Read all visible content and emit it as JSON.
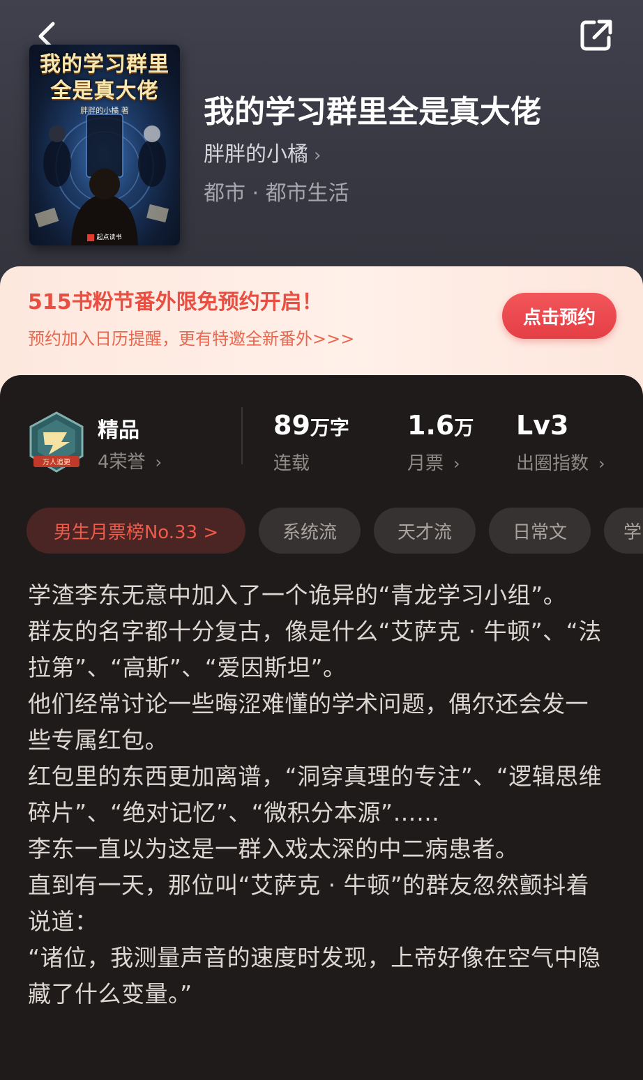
{
  "header": {
    "back": "back-arrow-icon",
    "share": "share-icon"
  },
  "book": {
    "cover_title_line1": "我的学习群里",
    "cover_title_line2": "全是真大佬",
    "cover_author": "胖胖的小橘 著",
    "cover_publisher": "起点读书",
    "title": "我的学习群里全是真大佬",
    "author": "胖胖的小橘",
    "genre": "都市 · 都市生活"
  },
  "promo": {
    "title": "515书粉节番外限免预约开启！",
    "subtitle": "预约加入日历提醒，更有特邀全新番外>>>",
    "button": "点击预约"
  },
  "stats": {
    "quality": "精品",
    "honors": "4荣誉",
    "badge_text": "万人追更",
    "words_num": "89",
    "words_unit": "万字",
    "words_label": "连载",
    "tickets_num": "1.6",
    "tickets_unit": "万",
    "tickets_label": "月票",
    "level": "Lv3",
    "level_label": "出圈指数",
    "chevron": "›"
  },
  "tags": [
    "男生月票榜No.33 >",
    "系统流",
    "天才流",
    "日常文",
    "学"
  ],
  "description": [
    "学渣李东无意中加入了一个诡异的“青龙学习小组”。",
    "群友的名字都十分复古，像是什么“艾萨克 · 牛顿”、“法拉第”、“高斯”、“爱因斯坦”。",
    "他们经常讨论一些晦涩难懂的学术问题，偶尔还会发一些专属红包。",
    "红包里的东西更加离谱，“洞穿真理的专注”、“逻辑思维碎片”、“绝对记忆”、“微积分本源”……",
    "李东一直以为这是一群入戏太深的中二病患者。",
    "直到有一天，那位叫“艾萨克 · 牛顿”的群友忽然颤抖着说道：",
    "“诸位，我测量声音的速度时发现，上帝好像在空气中隐藏了什么变量。”"
  ],
  "colors": {
    "accent": "#e94e42",
    "header_bg": "#3b3b46",
    "panel_bg": "#1e1b1a",
    "chip_bg": "#363231"
  }
}
